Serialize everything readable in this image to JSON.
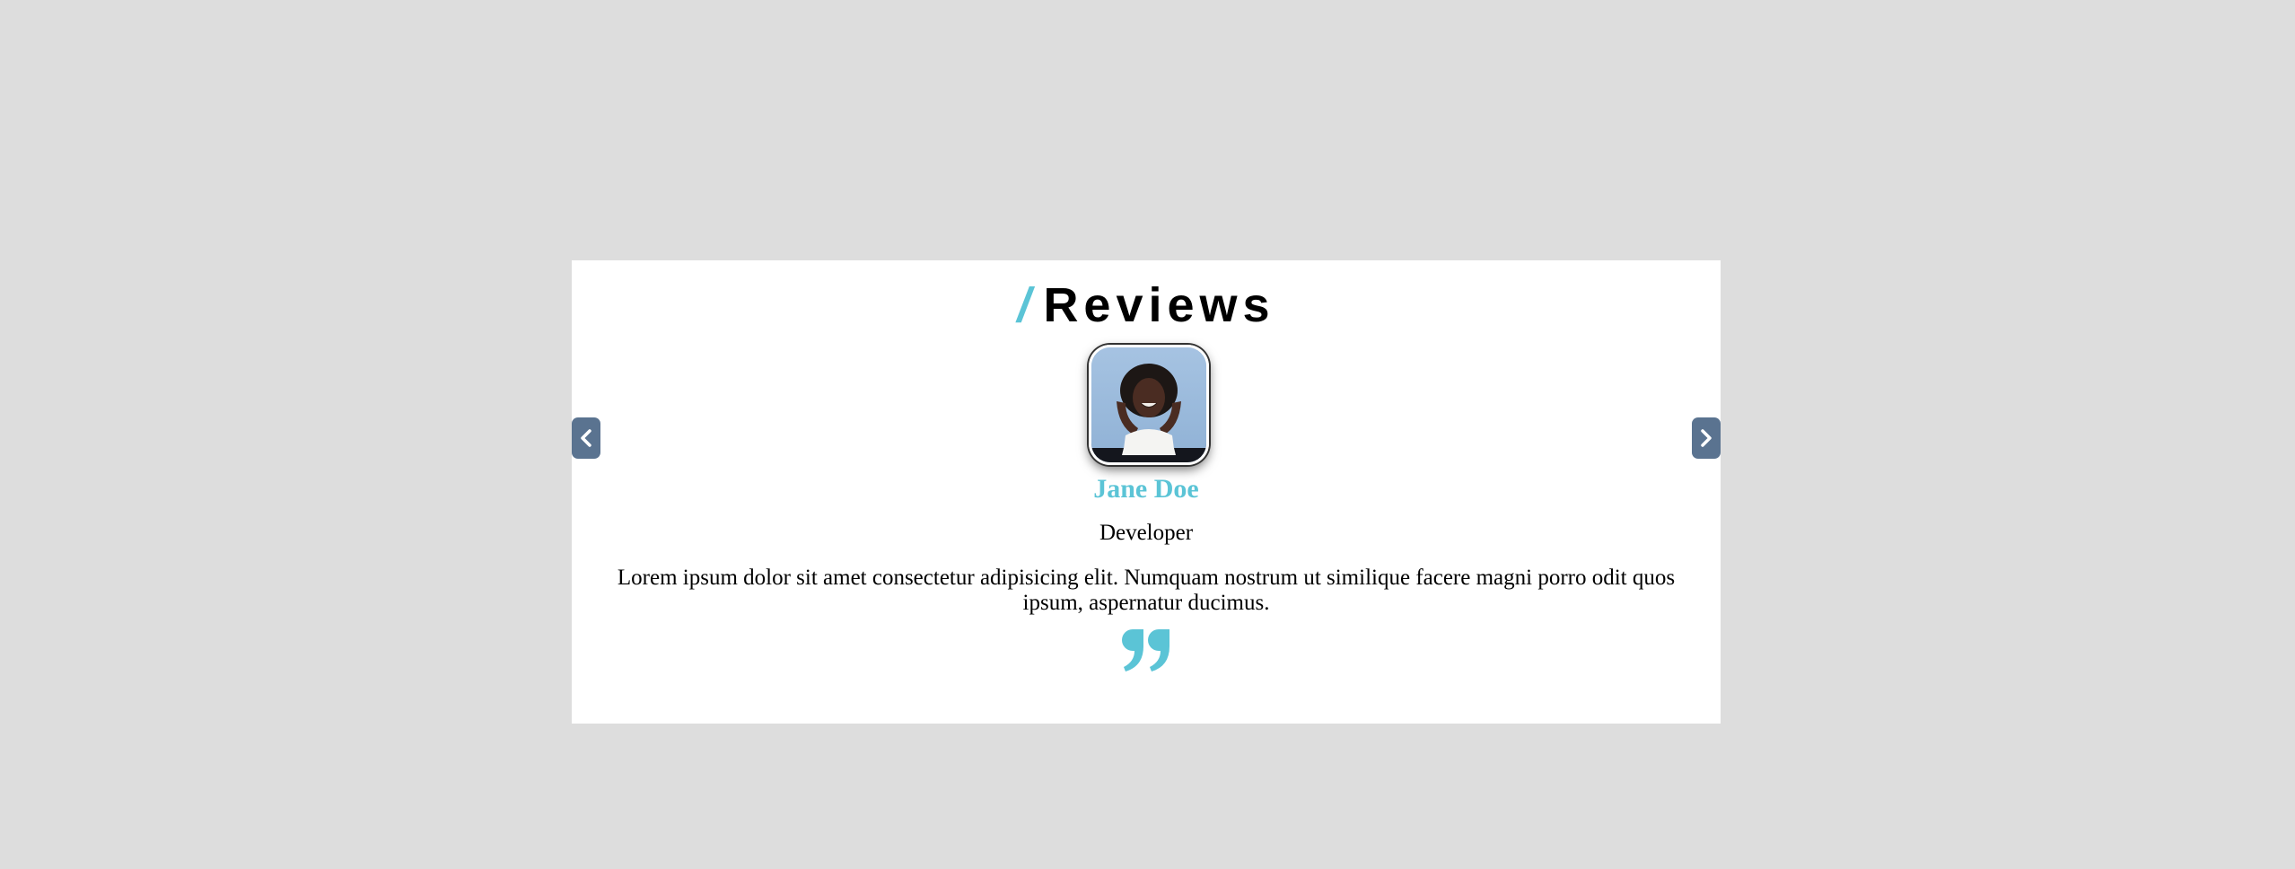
{
  "header": {
    "slash": "/",
    "title": "Reviews"
  },
  "review": {
    "name": "Jane Doe",
    "role": "Developer",
    "text": "Lorem ipsum dolor sit amet consectetur adipisicing elit. Numquam nostrum ut similique facere magni porro odit quos ipsum, aspernatur ducimus."
  },
  "icons": {
    "prev": "chevron-left-icon",
    "next": "chevron-right-icon",
    "quote": "quote-icon"
  },
  "colors": {
    "accent": "#5bc4d6",
    "nav_button": "#5a7390",
    "page_background": "#dddddd",
    "card_background": "#ffffff"
  }
}
